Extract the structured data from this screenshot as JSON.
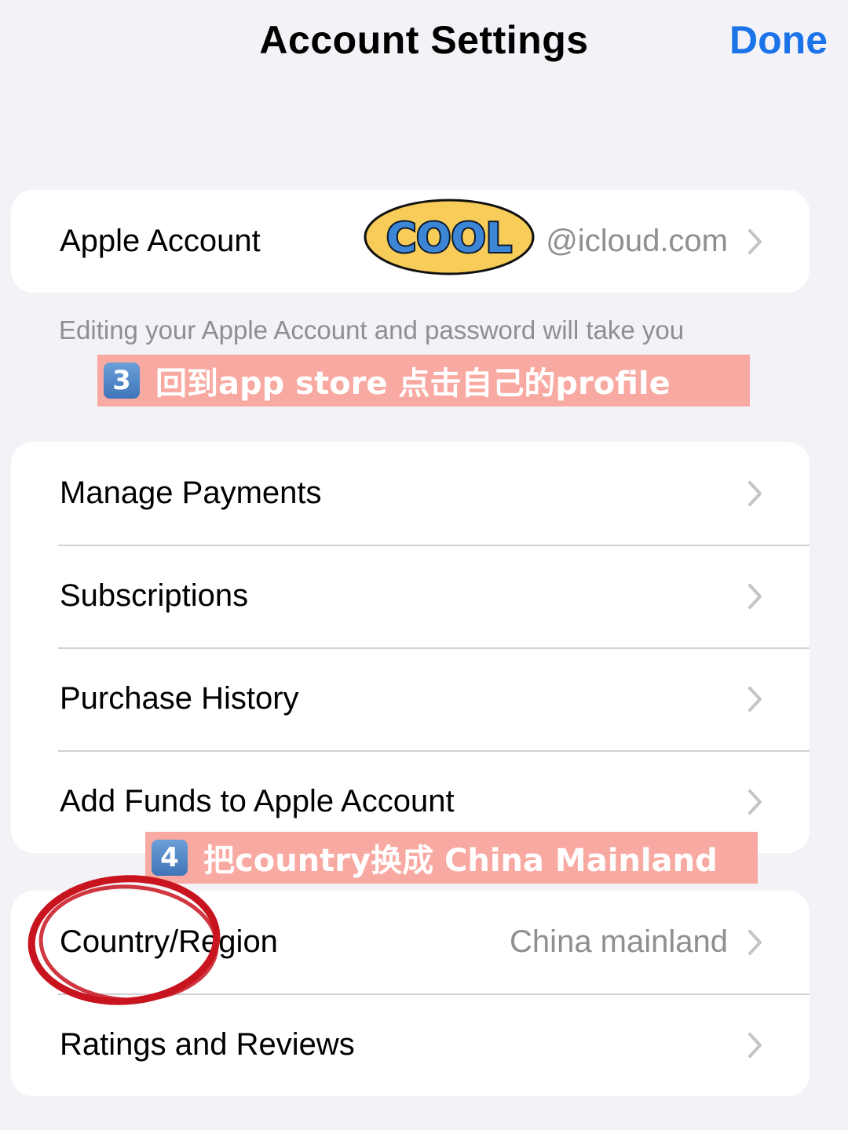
{
  "header": {
    "title": "Account Settings",
    "done_label": "Done"
  },
  "account_card": {
    "label": "Apple Account",
    "value": "@icloud.com"
  },
  "account_footer": "Editing your Apple Account and password will take you",
  "stickers": {
    "cool": "COOL",
    "step3": {
      "number": "3",
      "text": "回到app store 点击自己的profile"
    },
    "step4": {
      "number": "4",
      "text": "把country换成 China Mainland"
    }
  },
  "menu_items": [
    {
      "label": "Manage Payments"
    },
    {
      "label": "Subscriptions"
    },
    {
      "label": "Purchase History"
    },
    {
      "label": "Add Funds to Apple Account"
    }
  ],
  "region_card": {
    "country_label": "Country/Region",
    "country_value": "China mainland",
    "ratings_label": "Ratings and Reviews"
  },
  "colors": {
    "background": "#f2f2f7",
    "accent": "#1a73e8",
    "sticker_pink": "#f8a9a1",
    "circle_red": "#c8141e",
    "cool_yellow": "#f7cc58"
  }
}
